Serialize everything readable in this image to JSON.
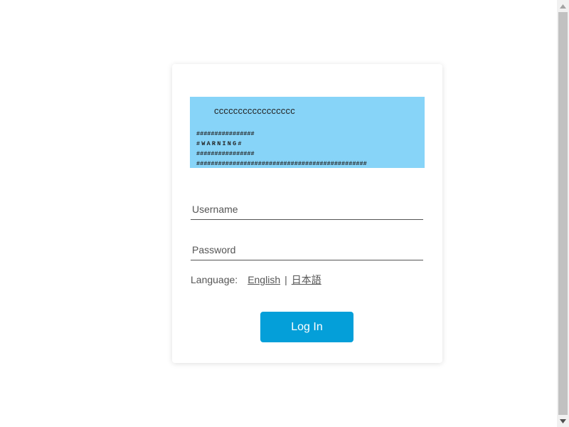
{
  "banner": {
    "title": "ccccccccccccccccc",
    "line1": "################",
    "line2": "#WARNING#",
    "line3": "################",
    "line4": "###############################################"
  },
  "form": {
    "username_placeholder": "Username",
    "username_value": "",
    "password_placeholder": "Password",
    "password_value": "",
    "language_label": "Language:",
    "lang_english": "English",
    "lang_separator": "|",
    "lang_japanese": "日本語",
    "login_label": "Log In"
  },
  "colors": {
    "banner_bg": "#87d4f8",
    "login_button": "#049fd9"
  },
  "icons": {
    "scroll_up": "triangle-up",
    "scroll_down": "triangle-down"
  }
}
